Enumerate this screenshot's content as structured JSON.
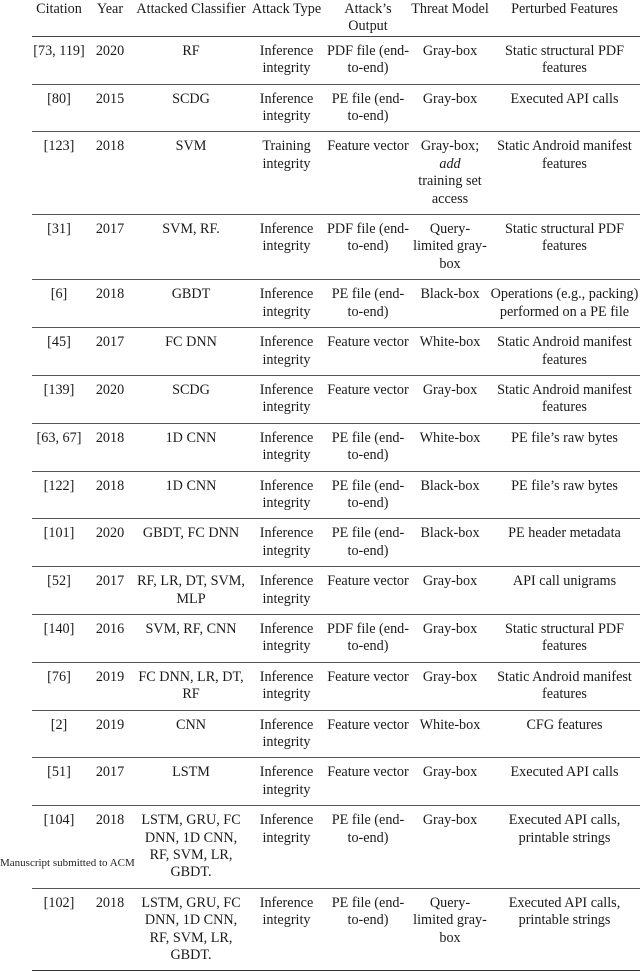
{
  "table": {
    "headers": {
      "citation": "Citation",
      "year": "Year",
      "classifier": "Attacked Classifier",
      "attack_type": "Attack Type",
      "output": "Attack’s Output",
      "threat_model": "Threat Model",
      "features": "Perturbed Features"
    },
    "rows": [
      {
        "citation": "[73, 119]",
        "year": "2020",
        "classifier": "RF",
        "attack_type": "Inference integrity",
        "output": "PDF file (end-to-end)",
        "threat_model": "Gray-box",
        "threat_model_extra": "",
        "threat_model_tail": "",
        "features": "Static structural PDF features"
      },
      {
        "citation": "[80]",
        "year": "2015",
        "classifier": "SCDG",
        "attack_type": "Inference integrity",
        "output": "PE file (end-to-end)",
        "threat_model": "Gray-box",
        "threat_model_extra": "",
        "threat_model_tail": "",
        "features": "Executed API calls"
      },
      {
        "citation": "[123]",
        "year": "2018",
        "classifier": "SVM",
        "attack_type": "Training integrity",
        "output": "Feature vector",
        "threat_model": "Gray-box;",
        "threat_model_extra": "add",
        "threat_model_tail": "training set access",
        "features": "Static Android manifest features"
      },
      {
        "citation": "[31]",
        "year": "2017",
        "classifier": "SVM, RF.",
        "attack_type": "Inference integrity",
        "output": "PDF file (end-to-end)",
        "threat_model": "Query-limited gray-box",
        "threat_model_extra": "",
        "threat_model_tail": "",
        "features": "Static structural PDF features"
      },
      {
        "citation": "[6]",
        "year": "2018",
        "classifier": "GBDT",
        "attack_type": "Inference integrity",
        "output": "PE file (end-to-end)",
        "threat_model": "Black-box",
        "threat_model_extra": "",
        "threat_model_tail": "",
        "features": "Operations (e.g., packing) performed on a PE file"
      },
      {
        "citation": "[45]",
        "year": "2017",
        "classifier": "FC DNN",
        "attack_type": "Inference integrity",
        "output": "Feature vector",
        "threat_model": "White-box",
        "threat_model_extra": "",
        "threat_model_tail": "",
        "features": "Static Android manifest features"
      },
      {
        "citation": "[139]",
        "year": "2020",
        "classifier": "SCDG",
        "attack_type": "Inference integrity",
        "output": "Feature vector",
        "threat_model": "Gray-box",
        "threat_model_extra": "",
        "threat_model_tail": "",
        "features": "Static Android manifest features"
      },
      {
        "citation": "[63, 67]",
        "year": "2018",
        "classifier": "1D CNN",
        "attack_type": "Inference integrity",
        "output": "PE file (end-to-end)",
        "threat_model": "White-box",
        "threat_model_extra": "",
        "threat_model_tail": "",
        "features": "PE file’s raw bytes"
      },
      {
        "citation": "[122]",
        "year": "2018",
        "classifier": "1D CNN",
        "attack_type": "Inference integrity",
        "output": "PE file (end-to-end)",
        "threat_model": "Black-box",
        "threat_model_extra": "",
        "threat_model_tail": "",
        "features": "PE file’s raw bytes"
      },
      {
        "citation": "[101]",
        "year": "2020",
        "classifier": "GBDT, FC DNN",
        "attack_type": "Inference integrity",
        "output": "PE file (end-to-end)",
        "threat_model": "Black-box",
        "threat_model_extra": "",
        "threat_model_tail": "",
        "features": "PE header metadata"
      },
      {
        "citation": "[52]",
        "year": "2017",
        "classifier": "RF, LR, DT, SVM, MLP",
        "attack_type": "Inference integrity",
        "output": "Feature vector",
        "threat_model": "Gray-box",
        "threat_model_extra": "",
        "threat_model_tail": "",
        "features": "API call unigrams"
      },
      {
        "citation": "[140]",
        "year": "2016",
        "classifier": "SVM, RF, CNN",
        "attack_type": "Inference integrity",
        "output": "PDF file (end-to-end)",
        "threat_model": "Gray-box",
        "threat_model_extra": "",
        "threat_model_tail": "",
        "features": "Static structural PDF features"
      },
      {
        "citation": "[76]",
        "year": "2019",
        "classifier": "FC DNN, LR, DT, RF",
        "attack_type": "Inference integrity",
        "output": "Feature vector",
        "threat_model": "Gray-box",
        "threat_model_extra": "",
        "threat_model_tail": "",
        "features": "Static Android manifest features"
      },
      {
        "citation": "[2]",
        "year": "2019",
        "classifier": "CNN",
        "attack_type": "Inference integrity",
        "output": "Feature vector",
        "threat_model": "White-box",
        "threat_model_extra": "",
        "threat_model_tail": "",
        "features": "CFG features"
      },
      {
        "citation": "[51]",
        "year": "2017",
        "classifier": "LSTM",
        "attack_type": "Inference integrity",
        "output": "Feature vector",
        "threat_model": "Gray-box",
        "threat_model_extra": "",
        "threat_model_tail": "",
        "features": "Executed API calls"
      },
      {
        "citation": "[104]",
        "year": "2018",
        "classifier": "LSTM, GRU, FC DNN, 1D CNN, RF, SVM, LR, GBDT.",
        "attack_type": "Inference integrity",
        "output": "PE file (end-to-end)",
        "threat_model": "Gray-box",
        "threat_model_extra": "",
        "threat_model_tail": "",
        "features": "Executed API calls, printable strings"
      },
      {
        "citation": "[102]",
        "year": "2018",
        "classifier": "LSTM, GRU, FC DNN, 1D CNN, RF, SVM, LR, GBDT.",
        "attack_type": "Inference integrity",
        "output": "PE file (end-to-end)",
        "threat_model": "Query-limited gray-box",
        "threat_model_extra": "",
        "threat_model_tail": "",
        "features": "Executed API calls, printable strings"
      }
    ]
  },
  "footer": {
    "text": "Manuscript submitted to ACM"
  }
}
